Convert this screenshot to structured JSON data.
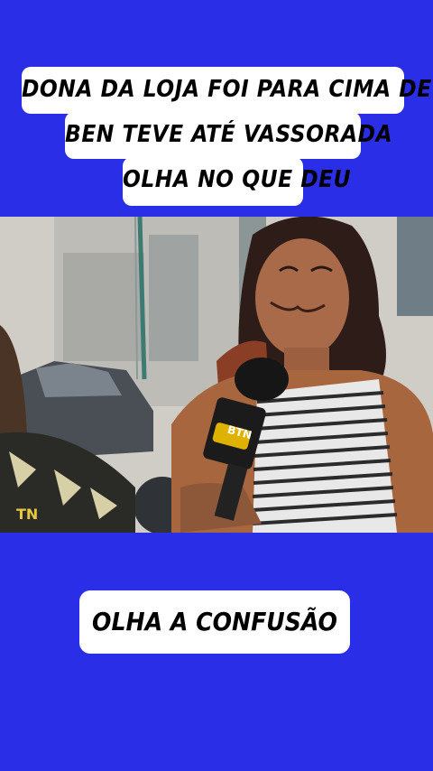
{
  "caption_top": {
    "line1": "DONA DA LOJA FOI PARA CIMA DE",
    "line2": "BEN TEVE ATÉ VASSORADA",
    "line3": "OLHA NO QUE DEU"
  },
  "video": {
    "mic_logo_text": "BTN",
    "left_mic_text": "TN"
  },
  "caption_bottom": "OLHA A CONFUSÃO"
}
